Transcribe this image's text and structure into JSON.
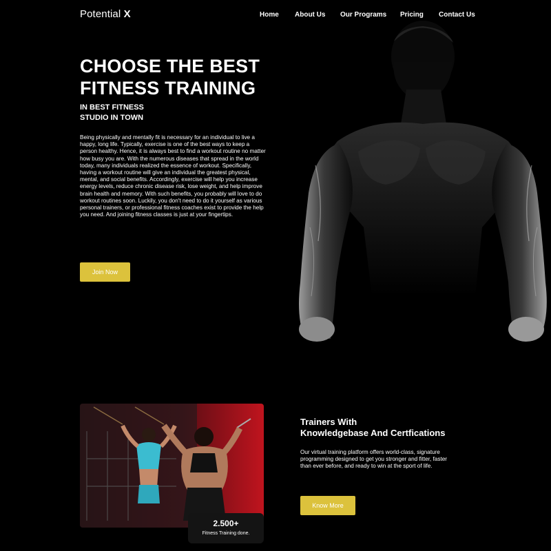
{
  "brand": {
    "name": "Potential",
    "mark": "X"
  },
  "nav": {
    "items": [
      {
        "label": "Home"
      },
      {
        "label": "About Us"
      },
      {
        "label": "Our Programs"
      },
      {
        "label": "Pricing"
      },
      {
        "label": "Contact Us"
      }
    ]
  },
  "hero": {
    "title_line1": "CHOOSE THE BEST",
    "title_line2": "FITNESS TRAINING",
    "subtitle_line1": "IN BEST FITNESS",
    "subtitle_line2": "STUDIO IN TOWN",
    "body": "Being physically and mentally fit is necessary for an individual to live a happy, long life. Typically, exercise is one of the best ways to keep a person healthy. Hence, it is always best to find a workout routine no matter how busy you are. With the numerous diseases that spread in the world today, many individuals realized the essence of workout. Specifically, having a workout routine will give an individual the greatest physical, mental, and social benefits. Accordingly, exercise will help you increase energy levels, reduce chronic disease risk, lose weight, and help improve brain health and memory. With such benefits, you probably will love to do workout routines soon. Luckily, you don't need to do it yourself as various personal trainers, or professional fitness coaches exist to provide the help you need. And joining fitness classes is just at your fingertips.",
    "cta_label": "Join Now"
  },
  "trainers": {
    "title_line1": "Trainers With",
    "title_line2": "Knowledgebase And Certfications",
    "body": "Our virtual training platform offers world-class, signature programming designed to get you stronger and fitter, faster than ever before, and ready to win at the sport of life.",
    "cta_label": "Know More",
    "stat_value": "2.500+",
    "stat_label": "Fitness Training done."
  },
  "colors": {
    "background": "#000000",
    "accent": "#dcc23c",
    "text": "#ffffff"
  }
}
